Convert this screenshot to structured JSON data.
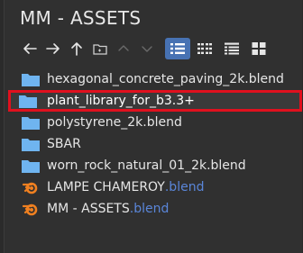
{
  "panel": {
    "title": "MM - ASSETS"
  },
  "toolbar": {
    "nav": [
      {
        "name": "back-arrow-icon"
      },
      {
        "name": "forward-arrow-icon"
      },
      {
        "name": "parent-directory-icon"
      },
      {
        "name": "new-folder-icon"
      },
      {
        "name": "chevron-up-icon"
      },
      {
        "name": "chevron-down-icon"
      }
    ],
    "views": [
      {
        "name": "vertical-list-view-icon",
        "active": true
      },
      {
        "name": "horizontal-list-view-icon",
        "active": false
      },
      {
        "name": "detailed-list-view-icon",
        "active": false
      },
      {
        "name": "thumbnail-view-icon",
        "active": false
      }
    ]
  },
  "files": [
    {
      "type": "folder",
      "name": "hexagonal_concrete_paving_2k.blend",
      "ext": ""
    },
    {
      "type": "folder",
      "name": "plant_library_for_b3.3+",
      "ext": "",
      "selected": true
    },
    {
      "type": "folder",
      "name": "polystyrene_2k.blend",
      "ext": ""
    },
    {
      "type": "folder",
      "name": "SBAR",
      "ext": ""
    },
    {
      "type": "folder",
      "name": "worn_rock_natural_01_2k.blend",
      "ext": ""
    },
    {
      "type": "blend",
      "name": "LAMPE CHAMEROY",
      "ext": ".blend"
    },
    {
      "type": "blend",
      "name": "MM - ASSETS",
      "ext": ".blend"
    }
  ],
  "colors": {
    "background": "#303030",
    "folder": "#6fb4f0",
    "blend_icon": "#f08020",
    "extension": "#5a86d9",
    "active_view": "#4772b3",
    "highlight": "#e0101e"
  }
}
